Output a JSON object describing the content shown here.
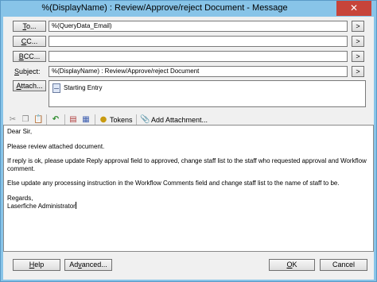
{
  "window": {
    "title": "%(DisplayName) : Review/Approve/reject Document - Message",
    "close_glyph": "✕"
  },
  "header": {
    "to_label": "To...",
    "to_accel": "T",
    "to_rest": "o...",
    "to_value": "%(QueryData_Email)",
    "cc_label": "CC...",
    "cc_accel": "C",
    "cc_rest": "C...",
    "cc_value": "",
    "bcc_label": "BCC...",
    "bcc_accel": "B",
    "bcc_rest": "CC...",
    "bcc_value": "",
    "subject_label": "Subject:",
    "subject_accel": "S",
    "subject_rest": "ubject:",
    "subject_value": "%(DisplayName) : Review/Approve/reject Document",
    "attach_label": "Attach...",
    "attach_accel": "A",
    "attach_rest": "ttach...",
    "arrow_glyph": ">",
    "attachments": [
      "Starting Entry"
    ]
  },
  "toolbar": {
    "tokens_label": "Tokens",
    "add_attachment_label": "Add Attachment..."
  },
  "body": {
    "lines": [
      "Dear Sir,",
      "",
      "Please review attached document.",
      "",
      "If reply is ok, please update Reply approval field to approved, change staff list to the staff who requested approval and Workflow comment.",
      "",
      "Else update any processing instruction in the Workflow Comments field and change staff list to the name of staff to be.",
      "",
      "Regards,",
      "Laserfiche Administrator"
    ]
  },
  "footer": {
    "help_label": "Help",
    "help_accel": "H",
    "help_rest": "elp",
    "advanced_label": "Advanced...",
    "advanced_accel": "v",
    "advanced_pre": "Ad",
    "advanced_rest": "anced...",
    "ok_label": "OK",
    "ok_accel": "O",
    "ok_rest": "K",
    "cancel_label": "Cancel"
  },
  "colors": {
    "titlebar": "#88c4e8",
    "close_button": "#c7443a",
    "client_background": "#f0f0f0"
  }
}
